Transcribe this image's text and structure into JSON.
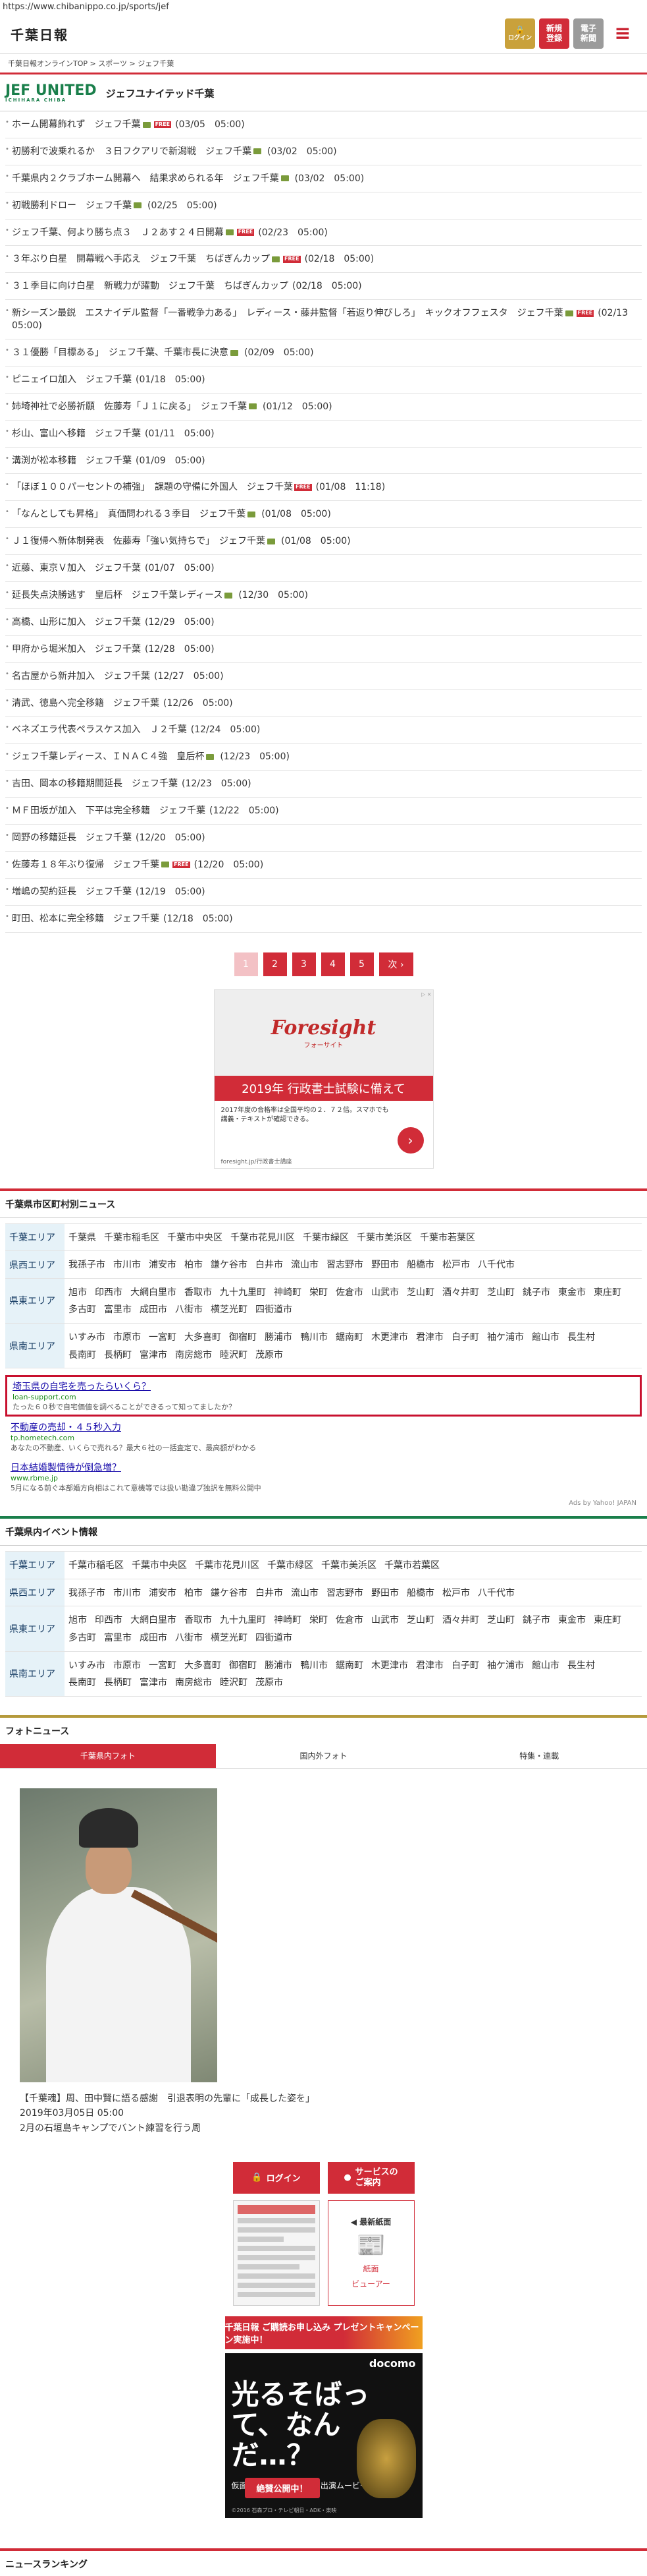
{
  "url": "https://www.chibanippo.co.jp/sports/jef",
  "header": {
    "logo": "千葉日報",
    "login": "ログイン",
    "register": [
      "新規",
      "登録"
    ],
    "paper": [
      "電子",
      "新聞"
    ]
  },
  "breadcrumb": "千葉日報オンラインTOP > スポーツ > ジェフ千葉",
  "team": {
    "logo": "JEF UNITED",
    "logo_sub": "ICHIHARA CHIBA",
    "name": "ジェフユナイテッド千葉"
  },
  "news": [
    {
      "text": "ホーム開幕飾れず　ジェフ千葉",
      "cam": true,
      "free": true,
      "date": "(03/05　05:00)"
    },
    {
      "text": "初勝利で波乗れるか　３日フクアリで新潟戦　ジェフ千葉",
      "cam": true,
      "free": false,
      "date": "(03/02　05:00)"
    },
    {
      "text": "千葉県内２クラブホーム開幕へ　結果求められる年　ジェフ千葉",
      "cam": true,
      "free": false,
      "date": "(03/02　05:00)"
    },
    {
      "text": "初戦勝利ドロー　ジェフ千葉",
      "cam": true,
      "free": false,
      "date": "(02/25　05:00)"
    },
    {
      "text": "ジェフ千葉、何より勝ち点３　Ｊ２あす２４日開幕",
      "cam": true,
      "free": true,
      "date": "(02/23　05:00)"
    },
    {
      "text": "３年ぶり白星　開幕戦へ手応え　ジェフ千葉　ちばぎんカップ",
      "cam": true,
      "free": true,
      "date": "(02/18　05:00)"
    },
    {
      "text": "３１季目に向け白星　新戦力が躍動　ジェフ千葉　ちばぎんカップ",
      "cam": false,
      "free": false,
      "date": "(02/18　05:00)"
    },
    {
      "text": "新シーズン最鋭　エスナイデル監督「一番戦争力ある」　レディース・藤井監督「若返り伸びしろ」　キックオフフェスタ　ジェフ千葉",
      "cam": true,
      "free": true,
      "date": "(02/13　05:00)"
    },
    {
      "text": "３１優勝「目標ある」　ジェフ千葉、千葉市長に決意",
      "cam": true,
      "free": false,
      "date": "(02/09　05:00)"
    },
    {
      "text": "ピニェイロ加入　ジェフ千葉",
      "cam": false,
      "free": false,
      "date": "(01/18　05:00)"
    },
    {
      "text": "姉埼神社で必勝祈願　佐藤寿「Ｊ１に戻る」　ジェフ千葉",
      "cam": true,
      "free": false,
      "date": "(01/12　05:00)"
    },
    {
      "text": "杉山、富山へ移籍　ジェフ千葉",
      "cam": false,
      "free": false,
      "date": "(01/11　05:00)"
    },
    {
      "text": "溝渕が松本移籍　ジェフ千葉",
      "cam": false,
      "free": false,
      "date": "(01/09　05:00)"
    },
    {
      "text": "「ほぼ１００パーセントの補強」　課題の守備に外国人　ジェフ千葉",
      "cam": false,
      "free": true,
      "date": "(01/08　11:18)"
    },
    {
      "text": "「なんとしても昇格」　真価問われる３季目　ジェフ千葉",
      "cam": true,
      "free": false,
      "date": "(01/08　05:00)"
    },
    {
      "text": "Ｊ１復帰へ新体制発表　佐藤寿「強い気持ちで」　ジェフ千葉",
      "cam": true,
      "free": false,
      "date": "(01/08　05:00)"
    },
    {
      "text": "近藤、東京Ｖ加入　ジェフ千葉",
      "cam": false,
      "free": false,
      "date": "(01/07　05:00)"
    },
    {
      "text": "延長失点決勝逃す　皇后杯　ジェフ千葉レディース",
      "cam": true,
      "free": false,
      "date": "(12/30　05:00)"
    },
    {
      "text": "高橋、山形に加入　ジェフ千葉",
      "cam": false,
      "free": false,
      "date": "(12/29　05:00)"
    },
    {
      "text": "甲府から堀米加入　ジェフ千葉",
      "cam": false,
      "free": false,
      "date": "(12/28　05:00)"
    },
    {
      "text": "名古屋から新井加入　ジェフ千葉",
      "cam": false,
      "free": false,
      "date": "(12/27　05:00)"
    },
    {
      "text": "清武、徳島へ完全移籍　ジェフ千葉",
      "cam": false,
      "free": false,
      "date": "(12/26　05:00)"
    },
    {
      "text": "ベネズエラ代表ペラスケス加入　Ｊ２千葉",
      "cam": false,
      "free": false,
      "date": "(12/24　05:00)"
    },
    {
      "text": "ジェフ千葉レディース、ＩＮＡＣ４強　皇后杯",
      "cam": true,
      "free": false,
      "date": "(12/23　05:00)"
    },
    {
      "text": "吉田、岡本の移籍期間延長　ジェフ千葉",
      "cam": false,
      "free": false,
      "date": "(12/23　05:00)"
    },
    {
      "text": "ＭＦ田坂が加入　下平は完全移籍　ジェフ千葉",
      "cam": false,
      "free": false,
      "date": "(12/22　05:00)"
    },
    {
      "text": "岡野の移籍延長　ジェフ千葉",
      "cam": false,
      "free": false,
      "date": "(12/20　05:00)"
    },
    {
      "text": "佐藤寿１８年ぶり復帰　ジェフ千葉",
      "cam": true,
      "free": true,
      "date": "(12/20　05:00)"
    },
    {
      "text": "増嶋の契約延長　ジェフ千葉",
      "cam": false,
      "free": false,
      "date": "(12/19　05:00)"
    },
    {
      "text": "町田、松本に完全移籍　ジェフ千葉",
      "cam": false,
      "free": false,
      "date": "(12/18　05:00)"
    }
  ],
  "pager": [
    "1",
    "2",
    "3",
    "4",
    "5",
    "次 ›"
  ],
  "ad": {
    "brand": "Foresight",
    "brand_sub": "フォーサイト",
    "headline": "2019年 行政書士試験に備えて",
    "body": "2017年度の合格率は全国平均の２．７２倍。スマホでも講義・テキストが確認できる。",
    "foot": "foresight.jp/行政書士講座",
    "x": "▷ ×"
  },
  "area_news": {
    "title": "千葉県市区町村別ニュース",
    "rows": [
      {
        "label": "千葉エリア",
        "items": [
          "千葉県",
          "千葉市稲毛区",
          "千葉市中央区",
          "千葉市花見川区",
          "千葉市緑区",
          "千葉市美浜区",
          "千葉市若葉区"
        ]
      },
      {
        "label": "県西エリア",
        "items": [
          "我孫子市",
          "市川市",
          "浦安市",
          "柏市",
          "鎌ケ谷市",
          "白井市",
          "流山市",
          "習志野市",
          "野田市",
          "船橋市",
          "松戸市",
          "八千代市"
        ]
      },
      {
        "label": "県東エリア",
        "items": [
          "旭市",
          "印西市",
          "大網白里市",
          "香取市",
          "九十九里町",
          "神崎町",
          "栄町",
          "佐倉市",
          "山武市",
          "芝山町",
          "酒々井町",
          "芝山町",
          "銚子市",
          "東金市",
          "東庄町",
          "多古町",
          "富里市",
          "成田市",
          "八街市",
          "横芝光町",
          "四街道市"
        ]
      },
      {
        "label": "県南エリア",
        "items": [
          "いすみ市",
          "市原市",
          "一宮町",
          "大多喜町",
          "御宿町",
          "勝浦市",
          "鴨川市",
          "鋸南町",
          "木更津市",
          "君津市",
          "白子町",
          "袖ケ浦市",
          "館山市",
          "長生村",
          "長南町",
          "長柄町",
          "富津市",
          "南房総市",
          "睦沢町",
          "茂原市"
        ]
      }
    ]
  },
  "text_ads": [
    {
      "title": "埼玉県の自宅を売ったらいくら？",
      "url": "loan-support.com",
      "desc": "たった６０秒で自宅価値を調べることができるって知ってましたか？"
    },
    {
      "title": "不動産の売却・４５秒入力",
      "url": "tp.hometech.com",
      "desc": "あなたの不動産、いくらで売れる？最大６社の一括査定で、最高額がわかる"
    },
    {
      "title": "日本結婚製情待が倒急増？",
      "url": "www.rbme.jp",
      "desc": "5月になる前ぐ本部婚方向相はこれて意機等では扱い勘違プ独訳を無料公開中"
    }
  ],
  "ads_by": "Ads by Yahoo! JAPAN",
  "event": {
    "title": "千葉県内イベント情報",
    "rows": [
      {
        "label": "千葉エリア",
        "items": [
          "千葉市稲毛区",
          "千葉市中央区",
          "千葉市花見川区",
          "千葉市緑区",
          "千葉市美浜区",
          "千葉市若葉区"
        ]
      },
      {
        "label": "県西エリア",
        "items": [
          "我孫子市",
          "市川市",
          "浦安市",
          "柏市",
          "鎌ケ谷市",
          "白井市",
          "流山市",
          "習志野市",
          "野田市",
          "船橋市",
          "松戸市",
          "八千代市"
        ]
      },
      {
        "label": "県東エリア",
        "items": [
          "旭市",
          "印西市",
          "大網白里市",
          "香取市",
          "九十九里町",
          "神崎町",
          "栄町",
          "佐倉市",
          "山武市",
          "芝山町",
          "酒々井町",
          "芝山町",
          "銚子市",
          "東金市",
          "東庄町",
          "多古町",
          "富里市",
          "成田市",
          "八街市",
          "横芝光町",
          "四街道市"
        ]
      },
      {
        "label": "県南エリア",
        "items": [
          "いすみ市",
          "市原市",
          "一宮町",
          "大多喜町",
          "御宿町",
          "勝浦市",
          "鴨川市",
          "鋸南町",
          "木更津市",
          "君津市",
          "白子町",
          "袖ケ浦市",
          "館山市",
          "長生村",
          "長南町",
          "長柄町",
          "富津市",
          "南房総市",
          "睦沢町",
          "茂原市"
        ]
      }
    ]
  },
  "photo": {
    "title": "フォトニュース",
    "tabs": [
      "千葉県内フォト",
      "国内外フォト",
      "特集・連載"
    ],
    "caption": "【千葉魂】周、田中賢に語る感謝　引退表明の先輩に「成長した姿を」",
    "date": "2019年03月05日 05:00",
    "sub": "2月の石垣島キャンプでバント練習を行う周"
  },
  "bottom": {
    "login": "ログイン",
    "service": [
      "サービスの",
      "ご案内"
    ],
    "paper_label": "◀ 最新紙面",
    "viewer": [
      "紙面",
      "ビューアー"
    ],
    "campaign": "千葉日報 ご購読お申し込み プレゼントキャンペーン実施中！",
    "docomo_brand": "docomo",
    "docomo_big": "光るそばっ て、なんだ…？",
    "docomo_sub": "仮面ライダーエグゼイド 出演ムービー",
    "docomo_cta": "絶賛公開中！",
    "docomo_copy": "©2016 石森プロ・テレビ朝日・ADK・東映"
  },
  "ranking_title": "ニュースランキング",
  "colors": {
    "accent": "#d12c38",
    "team_green": "#1a7f4b"
  }
}
